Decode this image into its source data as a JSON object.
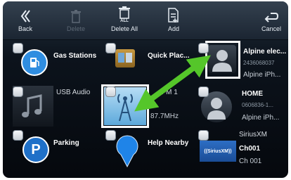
{
  "toolbar": {
    "back_label": "Back",
    "delete_label": "Delete",
    "delete_all_label": "Delete All",
    "add_label": "Add",
    "cancel_label": "Cancel"
  },
  "tiles": [
    {
      "title": "Gas Stations"
    },
    {
      "title": "Quick Plac..."
    },
    {
      "title": "Alpine elec...",
      "sub1": "2436068037",
      "sub2": "Alpine iPh..."
    },
    {
      "title": "USB Audio"
    },
    {
      "title": "FM 1",
      "sub1": "87.7MHz"
    },
    {
      "title": "HOME",
      "sub1": "0606836-1...",
      "sub2": "Alpine iPh..."
    },
    {
      "title": "Parking"
    },
    {
      "title": "Help Nearby"
    },
    {
      "title": "SiriusXM",
      "sub1": "Ch001",
      "sub2": "Ch 001",
      "logo_text": "((SiriusXM))"
    }
  ],
  "colors": {
    "accent_arrow": "#55c62a",
    "bg_dark": "#070b10",
    "toolbar": "#2a3542"
  },
  "icons": [
    "back-icon",
    "trash-icon",
    "delete-all-icon",
    "add-icon",
    "cancel-icon",
    "gas-pump-icon",
    "person-icon",
    "music-note-icon",
    "antenna-icon",
    "parking-icon",
    "help-pin-icon",
    "swap-arrow-icon"
  ]
}
